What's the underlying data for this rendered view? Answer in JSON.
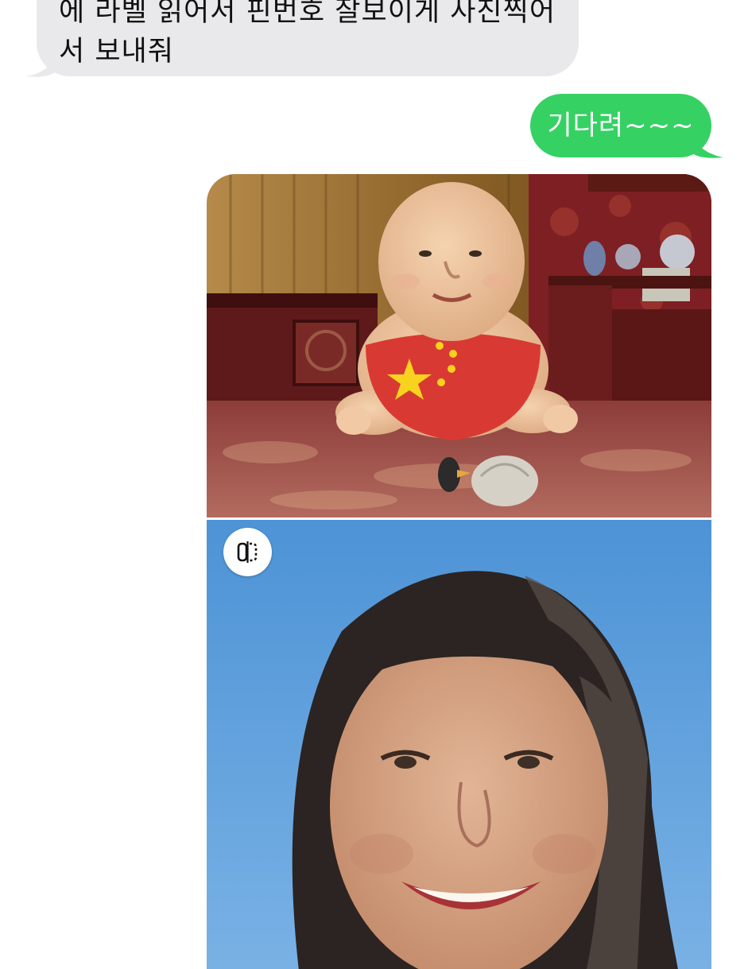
{
  "conversation": {
    "incoming_message": {
      "text": "에 라벨 읽어서 핀번호 잘보이게  사진찍어\n서  보내줘"
    },
    "outgoing_message": {
      "text": "기다려~~~"
    }
  },
  "colors": {
    "incoming_bubble": "#e9e9eb",
    "outgoing_bubble": "#35d163",
    "outgoing_text": "#ffffff"
  },
  "attachments": [
    {
      "kind": "image",
      "icon": "cartoon-baby-image"
    },
    {
      "kind": "image",
      "icon": "portrait-photo-image",
      "badge_icon": "live-photo-compare-icon"
    }
  ]
}
